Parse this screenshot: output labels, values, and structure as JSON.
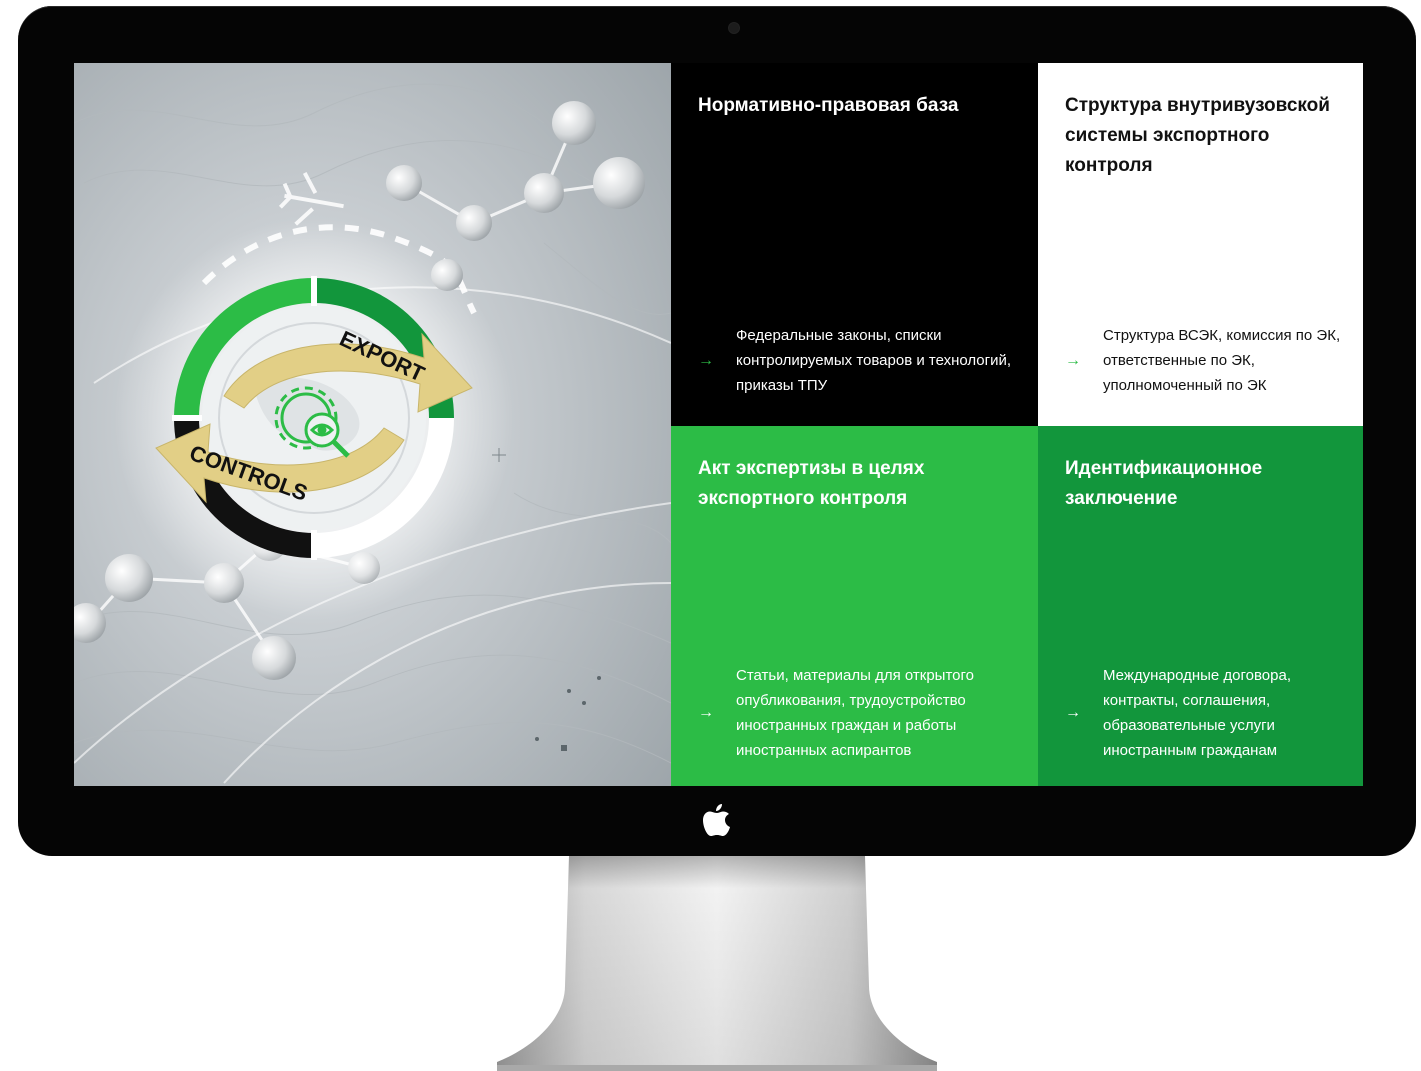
{
  "tiles": [
    {
      "title": "Нормативно-правовая база",
      "description": "Федеральные законы, списки контролируемых товаров и технологий, приказы ТПУ",
      "icon": "arrow-right-icon"
    },
    {
      "title": "Структура внутривузовской системы экспортного контроля",
      "description": "Структура ВСЭК, комиссия по ЭК, ответственные по ЭК, уполномоченный по ЭК",
      "icon": "arrow-right-icon"
    },
    {
      "title": "Акт экспертизы в целях экспортного контроля",
      "description": "Статьи, материалы для открытого опубликования, трудоустройство иностранных граждан и работы иностранных аспирантов",
      "icon": "arrow-right-icon"
    },
    {
      "title": "Идентификационное заключение",
      "description": "Международные договора, контракты, соглашения, образовательные услуги иностранным гражданам",
      "icon": "arrow-right-icon"
    }
  ],
  "hero": {
    "export_label": "EXPORT",
    "controls_label": "CONTROLS",
    "center_icon": "gear-eye-search-icon",
    "plane_icon": "airplane-icon"
  },
  "colors": {
    "tile_black": "#000000",
    "tile_white": "#ffffff",
    "tile_green": "#2cbc46",
    "tile_dark_green": "#12963c",
    "accent_gold": "#e2cf86"
  }
}
